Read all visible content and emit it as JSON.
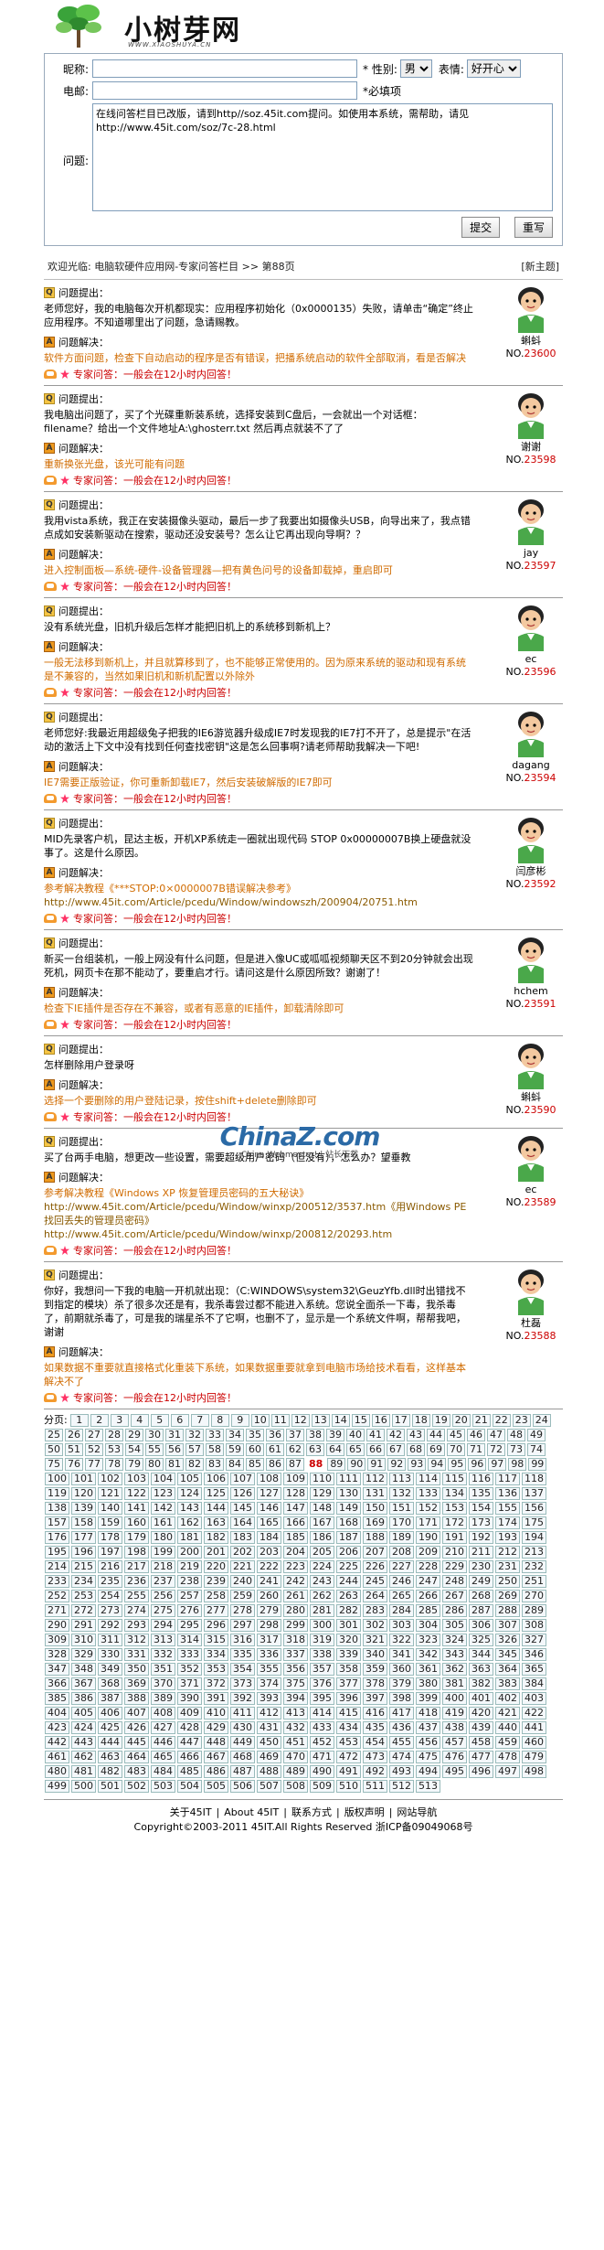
{
  "header": {
    "logo_text": "小树芽网",
    "logo_url": "WWW.XIAOSHUYA.CN"
  },
  "form": {
    "nickname_label": "昵称:",
    "gender_label": "性别:",
    "gender_value": "男",
    "mood_label": "表情:",
    "mood_value": "好开心",
    "email_label": "电邮:",
    "required_note": "*必填项",
    "question_label": "问题:",
    "question_value": "在线问答栏目已改版，请到http//soz.45it.com提问。如使用本系统，需帮助，请见http://www.45it.com/soz/7c-28.html",
    "submit_label": "提交",
    "reset_label": "重写"
  },
  "breadcrumb": {
    "text": "欢迎光临: 电脑软硬件应用网-专家问答栏目 >> 第88页",
    "new_topic": "[新主题]"
  },
  "labels": {
    "q": "问题提出：",
    "a": "问题解决：",
    "expert": "专家问答：一般会在12小时内回答！",
    "no_prefix": "NO."
  },
  "items": [
    {
      "q": "老师您好，我的电脑每次开机都现实：应用程序初始化（0x0000135）失败，请单击“确定”终止应用程序。不知道哪里出了问题，急请赐教。",
      "a": "软件方面问题，检查下自动启动的程序是否有错误，把播系统启动的软件全部取消，看是否解决",
      "name": "蝌蚪",
      "no": "23600"
    },
    {
      "q": "我电脑出问题了，买了个光碟重新装系统，选择安装到C盘后，一会就出一个对话框：filename？给出一个文件地址A:\\ghosterr.txt 然后再点就装不了了",
      "a": "重新换张光盘，该光可能有问题",
      "name": "谢谢",
      "no": "23598"
    },
    {
      "q": "我用vista系统，我正在安装摄像头驱动，最后一步了我要出如摄像头USB，向导出来了，我点错点成如安装新驱动在搜索，驱动还没安装号？怎么让它再出现向导啊？？",
      "a": "进入控制面板—系统-硬件-设备管理器—把有黄色问号的设备卸载掉，重启即可",
      "name": "jay",
      "no": "23597"
    },
    {
      "q": "没有系统光盘，旧机升级后怎样才能把旧机上的系统移到新机上？",
      "a": "一般无法移到新机上，并且就算移到了，也不能够正常使用的。因为原来系统的驱动和现有系统是不兼容的，当然如果旧机和新机配置以外除外",
      "name": "ec",
      "no": "23596"
    },
    {
      "q": "老师您好:我最近用超级兔子把我的IE6游览器升级成IE7时发现我的IE7打不开了，总是提示\"在活动的激活上下文中没有找到任何查找密钥\"这是怎么回事啊?请老师帮助我解决一下吧!",
      "a": "IE7需要正版验证，你可重新卸载IE7，然后安装破解版的IE7即可",
      "name": "dagang",
      "no": "23594"
    },
    {
      "q": "MID先录客户机，昆达主板，开机XP系统走一圈就出现代码 STOP 0x00000007B换上硬盘就没事了。这是什么原因。",
      "a": "参考解决教程《***STOP:0×0000007B错误解决参考》",
      "link": "http://www.45it.com/Article/pcedu/Window/windowszh/200904/20751.htm",
      "name": "闫彦彬",
      "no": "23592"
    },
    {
      "q": "新买一台组装机，一般上网没有什么问题，但是进入像UC或呱呱视频聊天区不到20分钟就会出现死机，网页卡在那不能动了，要重启才行。请问这是什么原因所致？谢谢了！",
      "a": "检查下IE插件是否存在不兼容，或者有恶意的IE插件，卸载清除即可",
      "name": "hchem",
      "no": "23591"
    },
    {
      "q": "怎样删除用户登录呀",
      "a": "选择一个要删除的用户登陆记录，按住shift+delete删除即可",
      "name": "蝌蚪",
      "no": "23590"
    },
    {
      "q": "买了台两手电脑，想更改一些设置，需要超级用户密码（但没有），怎么办？望垂教",
      "a": "参考解决教程《Windows XP 恢复管理员密码的五大秘诀》",
      "link": "http://www.45it.com/Article/pcedu/Window/winxp/200512/3537.htm《用Windows PE找回丢失的管理员密码》http://www.45it.com/Article/pcedu/Window/winxp/200812/20293.htm",
      "name": "ec",
      "no": "23589"
    },
    {
      "q": "你好，我想问一下我的电脑一开机就出现：（C:WINDOWS\\system32\\GeuzYfb.dll时出错找不到指定的模块）杀了很多次还是有，我杀毒尝过都不能进入系统。您说全面杀一下毒，我杀毒了，前期就杀毒了，可是我的瑞星杀不了它啊，也删不了，显示是一个系统文件啊，帮帮我吧，谢谢",
      "a": "如果数据不重要就直接格式化重装下系统，如果数据重要就拿到电脑市场给技术看看，这样基本解决不了",
      "name": "杜磊",
      "no": "23588"
    }
  ],
  "pager": {
    "label": "分页:",
    "current": "88",
    "pages": [
      "1",
      "2",
      "3",
      "4",
      "5",
      "6",
      "7",
      "8",
      "9",
      "10",
      "11",
      "12",
      "13",
      "14",
      "15",
      "16",
      "17",
      "18",
      "19",
      "20",
      "21",
      "22",
      "23",
      "24",
      "25",
      "26",
      "27",
      "28",
      "29",
      "30",
      "31",
      "32",
      "33",
      "34",
      "35",
      "36",
      "37",
      "38",
      "39",
      "40",
      "41",
      "42",
      "43",
      "44",
      "45",
      "46",
      "47",
      "48",
      "49",
      "50",
      "51",
      "52",
      "53",
      "54",
      "55",
      "56",
      "57",
      "58",
      "59",
      "60",
      "61",
      "62",
      "63",
      "64",
      "65",
      "66",
      "67",
      "68",
      "69",
      "70",
      "71",
      "72",
      "73",
      "74",
      "75",
      "76",
      "77",
      "78",
      "79",
      "80",
      "81",
      "82",
      "83",
      "84",
      "85",
      "86",
      "87",
      "88",
      "89",
      "90",
      "91",
      "92",
      "93",
      "94",
      "95",
      "96",
      "97",
      "98",
      "99",
      "100",
      "101",
      "102",
      "103",
      "104",
      "105",
      "106",
      "107",
      "108",
      "109",
      "110",
      "111",
      "112",
      "113",
      "114",
      "115",
      "116",
      "117",
      "118",
      "119",
      "120",
      "121",
      "122",
      "123",
      "124",
      "125",
      "126",
      "127",
      "128",
      "129",
      "130",
      "131",
      "132",
      "133",
      "134",
      "135",
      "136",
      "137",
      "138",
      "139",
      "140",
      "141",
      "142",
      "143",
      "144",
      "145",
      "146",
      "147",
      "148",
      "149",
      "150",
      "151",
      "152",
      "153",
      "154",
      "155",
      "156",
      "157",
      "158",
      "159",
      "160",
      "161",
      "162",
      "163",
      "164",
      "165",
      "166",
      "167",
      "168",
      "169",
      "170",
      "171",
      "172",
      "173",
      "174",
      "175",
      "176",
      "177",
      "178",
      "179",
      "180",
      "181",
      "182",
      "183",
      "184",
      "185",
      "186",
      "187",
      "188",
      "189",
      "190",
      "191",
      "192",
      "193",
      "194",
      "195",
      "196",
      "197",
      "198",
      "199",
      "200",
      "201",
      "202",
      "203",
      "204",
      "205",
      "206",
      "207",
      "208",
      "209",
      "210",
      "211",
      "212",
      "213",
      "214",
      "215",
      "216",
      "217",
      "218",
      "219",
      "220",
      "221",
      "222",
      "223",
      "224",
      "225",
      "226",
      "227",
      "228",
      "229",
      "230",
      "231",
      "232",
      "233",
      "234",
      "235",
      "236",
      "237",
      "238",
      "239",
      "240",
      "241",
      "242",
      "243",
      "244",
      "245",
      "246",
      "247",
      "248",
      "249",
      "250",
      "251",
      "252",
      "253",
      "254",
      "255",
      "256",
      "257",
      "258",
      "259",
      "260",
      "261",
      "262",
      "263",
      "264",
      "265",
      "266",
      "267",
      "268",
      "269",
      "270",
      "271",
      "272",
      "273",
      "274",
      "275",
      "276",
      "277",
      "278",
      "279",
      "280",
      "281",
      "282",
      "283",
      "284",
      "285",
      "286",
      "287",
      "288",
      "289",
      "290",
      "291",
      "292",
      "293",
      "294",
      "295",
      "296",
      "297",
      "298",
      "299",
      "300",
      "301",
      "302",
      "303",
      "304",
      "305",
      "306",
      "307",
      "308",
      "309",
      "310",
      "311",
      "312",
      "313",
      "314",
      "315",
      "316",
      "317",
      "318",
      "319",
      "320",
      "321",
      "322",
      "323",
      "324",
      "325",
      "326",
      "327",
      "328",
      "329",
      "330",
      "331",
      "332",
      "333",
      "334",
      "335",
      "336",
      "337",
      "338",
      "339",
      "340",
      "341",
      "342",
      "343",
      "344",
      "345",
      "346",
      "347",
      "348",
      "349",
      "350",
      "351",
      "352",
      "353",
      "354",
      "355",
      "356",
      "357",
      "358",
      "359",
      "360",
      "361",
      "362",
      "363",
      "364",
      "365",
      "366",
      "367",
      "368",
      "369",
      "370",
      "371",
      "372",
      "373",
      "374",
      "375",
      "376",
      "377",
      "378",
      "379",
      "380",
      "381",
      "382",
      "383",
      "384",
      "385",
      "386",
      "387",
      "388",
      "389",
      "390",
      "391",
      "392",
      "393",
      "394",
      "395",
      "396",
      "397",
      "398",
      "399",
      "400",
      "401",
      "402",
      "403",
      "404",
      "405",
      "406",
      "407",
      "408",
      "409",
      "410",
      "411",
      "412",
      "413",
      "414",
      "415",
      "416",
      "417",
      "418",
      "419",
      "420",
      "421",
      "422",
      "423",
      "424",
      "425",
      "426",
      "427",
      "428",
      "429",
      "430",
      "431",
      "432",
      "433",
      "434",
      "435",
      "436",
      "437",
      "438",
      "439",
      "440",
      "441",
      "442",
      "443",
      "444",
      "445",
      "446",
      "447",
      "448",
      "449",
      "450",
      "451",
      "452",
      "453",
      "454",
      "455",
      "456",
      "457",
      "458",
      "459",
      "460",
      "461",
      "462",
      "463",
      "464",
      "465",
      "466",
      "467",
      "468",
      "469",
      "470",
      "471",
      "472",
      "473",
      "474",
      "475",
      "476",
      "477",
      "478",
      "479",
      "480",
      "481",
      "482",
      "483",
      "484",
      "485",
      "486",
      "487",
      "488",
      "489",
      "490",
      "491",
      "492",
      "493",
      "494",
      "495",
      "496",
      "497",
      "498",
      "499",
      "500",
      "501",
      "502",
      "503",
      "504",
      "505",
      "506",
      "507",
      "508",
      "509",
      "510",
      "511",
      "512",
      "513"
    ]
  },
  "footer": {
    "links": [
      "关于45IT",
      "About 45IT",
      "联系方式",
      "版权声明",
      "网站导航"
    ],
    "copyright": "Copyright©2003-2011 45IT.All Rights Reserved  浙ICP备09049068号"
  },
  "watermark": {
    "logo": "ChinaZ.com",
    "sub": "China Webmaster! | 站长下载"
  },
  "colors": {
    "answer": "#d06b00",
    "expert_red": "#c00",
    "link_blue": "#2b6aa6"
  }
}
